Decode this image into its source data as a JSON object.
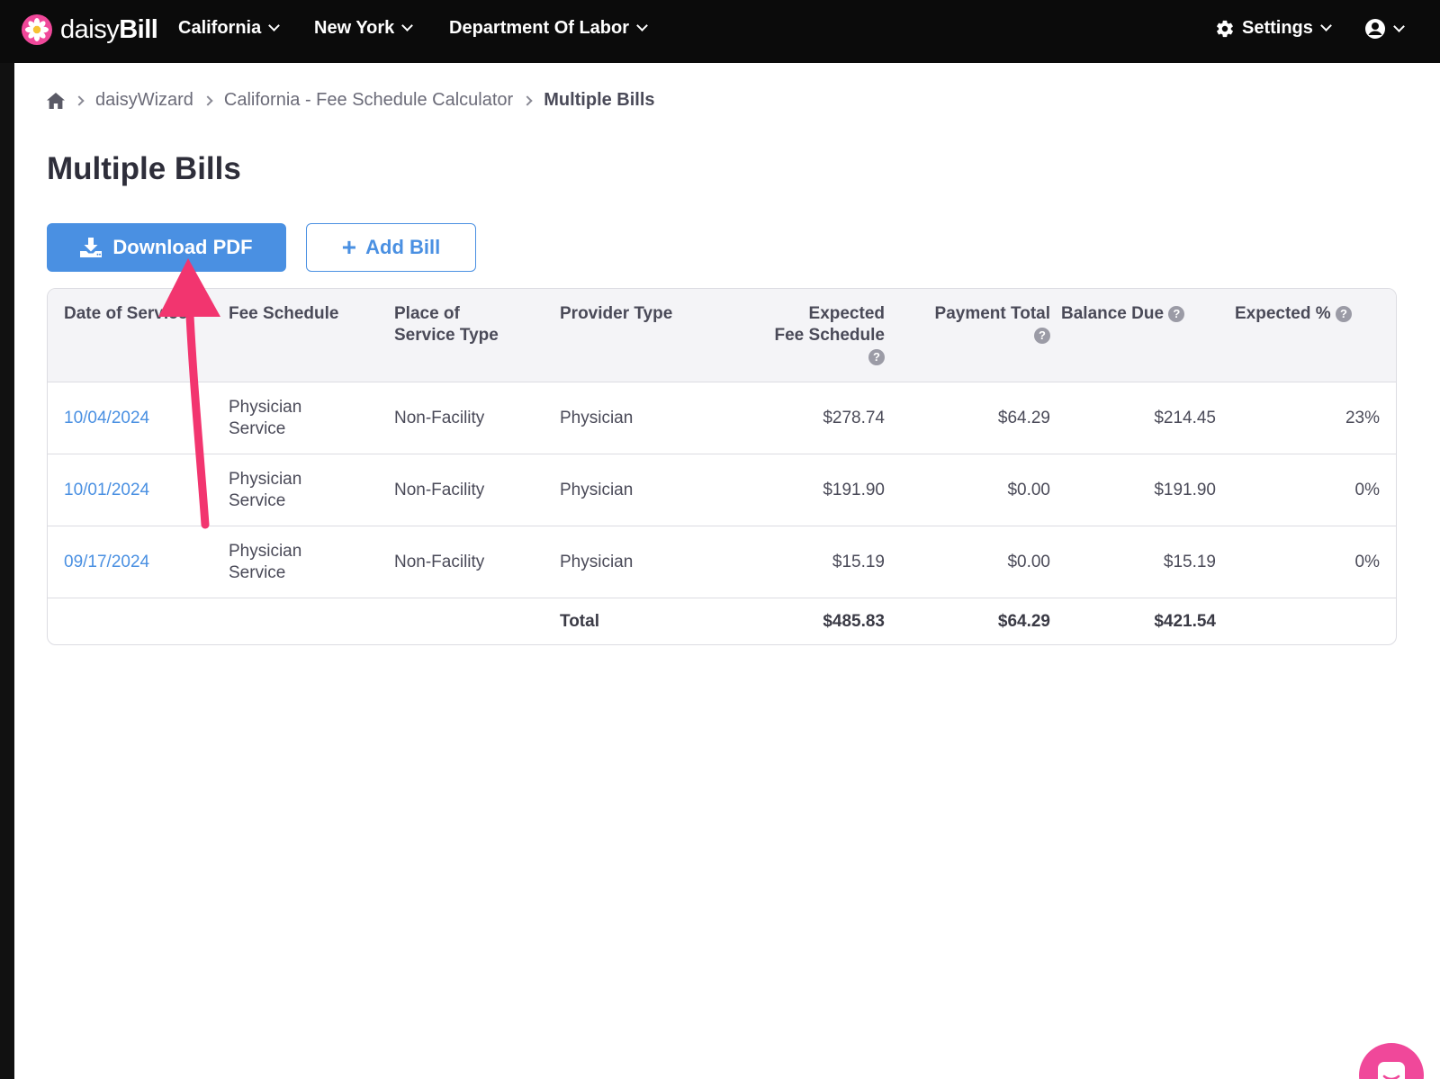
{
  "brand": {
    "name_light": "daisy",
    "name_bold": "Bill"
  },
  "nav": {
    "items": [
      {
        "label": "California"
      },
      {
        "label": "New York"
      },
      {
        "label": "Department Of Labor"
      }
    ],
    "settings_label": "Settings"
  },
  "breadcrumb": {
    "items": [
      "daisyWizard",
      "California - Fee Schedule Calculator"
    ],
    "current": "Multiple Bills"
  },
  "page": {
    "title": "Multiple Bills"
  },
  "actions": {
    "download_label": "Download PDF",
    "add_label": "Add Bill"
  },
  "table": {
    "headers": {
      "date": "Date of Service",
      "fee_schedule": "Fee Schedule",
      "place_line1": "Place of",
      "place_line2": "Service Type",
      "provider": "Provider Type",
      "expected_line1": "Expected",
      "expected_line2": "Fee Schedule",
      "payment": "Payment Total",
      "balance": "Balance Due",
      "expected_pct": "Expected %"
    },
    "rows": [
      {
        "date": "10/04/2024",
        "fee_line1": "Physician",
        "fee_line2": "Service",
        "place": "Non-Facility",
        "provider": "Physician",
        "expected": "$278.74",
        "payment": "$64.29",
        "balance": "$214.45",
        "pct": "23%"
      },
      {
        "date": "10/01/2024",
        "fee_line1": "Physician",
        "fee_line2": "Service",
        "place": "Non-Facility",
        "provider": "Physician",
        "expected": "$191.90",
        "payment": "$0.00",
        "balance": "$191.90",
        "pct": "0%"
      },
      {
        "date": "09/17/2024",
        "fee_line1": "Physician",
        "fee_line2": "Service",
        "place": "Non-Facility",
        "provider": "Physician",
        "expected": "$15.19",
        "payment": "$0.00",
        "balance": "$15.19",
        "pct": "0%"
      }
    ],
    "total": {
      "label": "Total",
      "expected": "$485.83",
      "payment": "$64.29",
      "balance": "$421.54"
    }
  },
  "colors": {
    "accent": "#4a90e2",
    "annotation": "#f2356f",
    "chat": "#f0489a"
  },
  "icons": [
    "daisy-logo-icon",
    "chevron-down-icon",
    "gear-icon",
    "user-circle-icon",
    "home-icon",
    "download-icon",
    "plus-icon",
    "help-icon",
    "chat-icon",
    "annotation-arrow"
  ]
}
